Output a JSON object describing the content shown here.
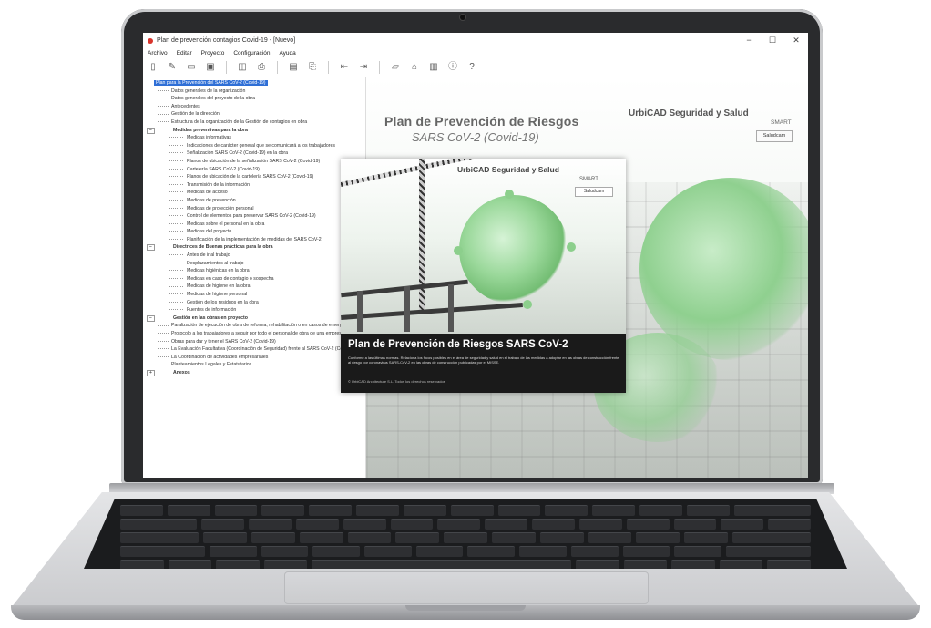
{
  "window": {
    "title": "Plan de prevención contagios Covid-19 - [Nuevo]",
    "controls": [
      "−",
      "☐",
      "✕"
    ]
  },
  "menu": [
    "Archivo",
    "Editar",
    "Proyecto",
    "Configuración",
    "Ayuda"
  ],
  "toolbar_icons": [
    "new-icon",
    "edit-icon",
    "open-icon",
    "save-icon",
    "preview-icon",
    "print-icon",
    "export-icon",
    "attach-icon",
    "previous-icon",
    "next-icon",
    "document-icon",
    "home-icon",
    "report-icon",
    "info-icon",
    "help-icon"
  ],
  "tree": {
    "root": "Plan para la Prevención del SARS CoV-2 (Covid-19)",
    "top_items": [
      "Datos generales de la organización",
      "Datos generales del proyecto de la obra",
      "Antecedentes",
      "Gestión de la dirección",
      "Estructura de la organización de la Gestión de contagios en obra"
    ],
    "groups": [
      {
        "label": "Medidas preventivas para la obra",
        "items": [
          "Medidas informativas",
          "Indicaciones de carácter general que se comunicará a los trabajadores",
          "Señalización SARS CoV-2 (Covid-19) en la obra",
          "Planos de ubicación de la señalización SARS CoV-2 (Covid-19)",
          "Cartelería SARS CoV-2 (Covid-19)",
          "Planos de ubicación de la cartelería SARS CoV-2 (Covid-19)",
          "Transmisión de la información",
          "Medidas de acceso",
          "Medidas de prevención",
          "Medidas de protección personal",
          "Control de elementos para preservar SARS CoV-2 (Covid-19)",
          "Medidas sobre el personal en la obra",
          "Medidas del proyecto",
          "Planificación de la implementación de medidas del SARS CoV-2"
        ]
      },
      {
        "label": "Directrices de Buenas prácticas para la obra",
        "items": [
          "Antes de ir al trabajo",
          "Desplazamientos al trabajo",
          "Medidas higiénicas en la obra",
          "Medidas en caso de contagio o sospecha",
          "Medidas de higiene en la obra",
          "Medidas de higiene personal",
          "Gestión de los residuos en la obra",
          "Fuentes de información"
        ]
      },
      {
        "label": "Gestión en las obras en proyecto",
        "items": [
          "Paralización de ejecución de obra de reforma, rehabilitación o en casos de emergencia",
          "Protocolo a los trabajadores a seguir por todo el personal de obra de una empresa",
          "Obras para dar y tener el SARS CoV-2 (Covid-19)",
          "La Evaluación Facultativa (Coordinación de Seguridad) frente al SARS CoV-2 (Covid-19)",
          "La Coordinación de actividades empresariales",
          "Planteamientos Legales y Estatutarios"
        ]
      },
      {
        "label": "Anexos",
        "items": []
      }
    ]
  },
  "content": {
    "title": "Plan de Prevención de Riesgos",
    "subtitle": "SARS CoV-2 (Covid-19)",
    "brand": "UrbiCAD Seguridad y Salud",
    "smart": "SMART",
    "button": "Saludcam"
  },
  "splash": {
    "brand": "UrbiCAD Seguridad y Salud",
    "smart": "SMART",
    "button": "Saludcam",
    "title": "Plan de Prevención de Riesgos SARS CoV-2",
    "description": "Conforme a las últimas normas. Relaciona los focos posibles en el área de seguridad y salud en el trabajo de las medidas a adoptar en las obras de construcción frente al riesgo por coronavirus SARS-CoV-2 en las obras de construcción publicadas por el MISSE.",
    "copyright": "© UrbiCAD Architecture S.L. Todos los derechos reservados"
  }
}
